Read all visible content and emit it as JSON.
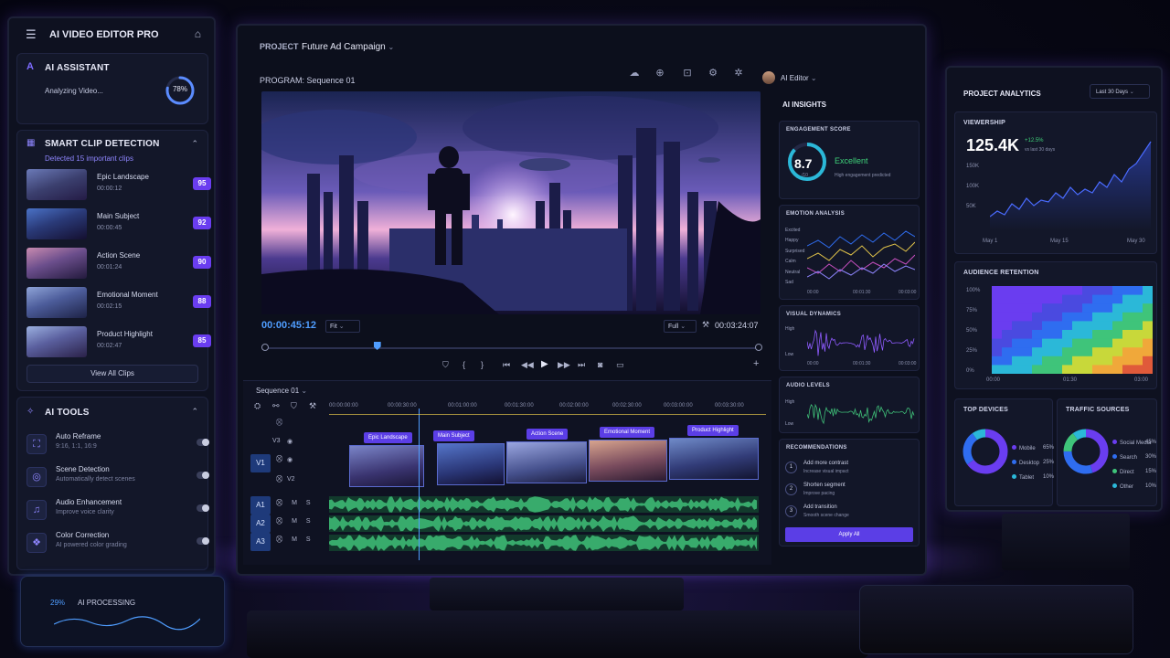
{
  "left": {
    "app_title": "AI VIDEO EDITOR PRO",
    "assistant": {
      "title": "AI ASSISTANT",
      "status": "Analyzing Video...",
      "progress_label": "78%",
      "progress": 0.78
    },
    "detection": {
      "title": "SMART CLIP DETECTION",
      "subtitle": "Detected 15 important clips",
      "clips": [
        {
          "title": "Epic Landscape",
          "time": "00:00:12",
          "score": "95"
        },
        {
          "title": "Main Subject",
          "time": "00:00:45",
          "score": "92"
        },
        {
          "title": "Action Scene",
          "time": "00:01:24",
          "score": "90"
        },
        {
          "title": "Emotional Moment",
          "time": "00:02:15",
          "score": "88"
        },
        {
          "title": "Product Highlight",
          "time": "00:02:47",
          "score": "85"
        }
      ],
      "view_all": "View All Clips"
    },
    "tools": {
      "title": "AI TOOLS",
      "items": [
        {
          "title": "Auto Reframe",
          "sub": "9:16, 1:1, 16:9"
        },
        {
          "title": "Scene Detection",
          "sub": "Automatically detect scenes"
        },
        {
          "title": "Audio Enhancement",
          "sub": "Improve voice clarity"
        },
        {
          "title": "Color Correction",
          "sub": "AI powered color grading"
        }
      ]
    }
  },
  "center": {
    "project_label": "PROJECT",
    "project_name": "Future Ad Campaign",
    "program_label": "PROGRAM: Sequence 01",
    "user": "AI Editor",
    "current_time": "00:00:45:12",
    "fit": "Fit",
    "full": "Full",
    "duration": "00:03:24:07",
    "playhead_fraction": 0.23,
    "sequence": "Sequence 01",
    "ruler": [
      "00:00:00:00",
      "00:00:30:00",
      "00:01:00:00",
      "00:01:30:00",
      "00:02:00:00",
      "00:02:30:00",
      "00:03:00:00",
      "00:03:30:00"
    ],
    "tracks": {
      "v3": "V3",
      "v2": "V2",
      "v1": "V1",
      "v2b": "V2",
      "a1": "A1",
      "a2": "A2",
      "a3": "A3"
    },
    "clip_tags": [
      "Epic Landscape",
      "Main Subject",
      "Action Scene",
      "Emotional Moment",
      "Product Highlight"
    ],
    "insights": {
      "title": "AI INSIGHTS",
      "engagement": {
        "title": "ENGAGEMENT SCORE",
        "score": "8.7",
        "out_of": "/10",
        "rating": "Excellent",
        "note": "High engagement predicted"
      },
      "emotion": {
        "title": "EMOTION ANALYSIS",
        "labels": [
          "Excited",
          "Happy",
          "Surprised",
          "Calm",
          "Neutral",
          "Sad"
        ],
        "times": [
          "00:00",
          "00:01:30",
          "00:03:00"
        ]
      },
      "visual": {
        "title": "VISUAL DYNAMICS",
        "high": "High",
        "low": "Low",
        "times": [
          "00:00",
          "00:01:30",
          "00:03:00"
        ]
      },
      "audio": {
        "title": "AUDIO LEVELS",
        "high": "High",
        "low": "Low"
      },
      "recommendations": {
        "title": "RECOMMENDATIONS",
        "items": [
          {
            "n": "1",
            "title": "Add more contrast",
            "sub": "Increase visual impact"
          },
          {
            "n": "2",
            "title": "Shorten segment",
            "sub": "Improve pacing"
          },
          {
            "n": "3",
            "title": "Add transition",
            "sub": "Smooth scene change"
          }
        ],
        "apply": "Apply All"
      }
    }
  },
  "right": {
    "title": "PROJECT ANALYTICS",
    "range": "Last 30 Days",
    "viewership": {
      "title": "VIEWERSHIP",
      "value": "125.4K",
      "change": "+12.5%",
      "change_note": "vs last 30 days",
      "y_ticks": [
        "150K",
        "100K",
        "50K"
      ],
      "x_ticks": [
        "May 1",
        "May 15",
        "May 30"
      ]
    },
    "retention": {
      "title": "AUDIENCE RETENTION",
      "y_ticks": [
        "100%",
        "75%",
        "50%",
        "25%",
        "0%"
      ],
      "x_ticks": [
        "00:00",
        "01:30",
        "03:00"
      ]
    },
    "devices": {
      "title": "TOP DEVICES",
      "items": [
        {
          "name": "Mobile",
          "pct": "65%",
          "value": 65,
          "color": "#6a3df0"
        },
        {
          "name": "Desktop",
          "pct": "25%",
          "value": 25,
          "color": "#2f6df0"
        },
        {
          "name": "Tablet",
          "pct": "10%",
          "value": 10,
          "color": "#2bb8d8"
        }
      ]
    },
    "traffic": {
      "title": "TRAFFIC SOURCES",
      "items": [
        {
          "name": "Social Media",
          "pct": "45%",
          "value": 45,
          "color": "#6a3df0"
        },
        {
          "name": "Search",
          "pct": "30%",
          "value": 30,
          "color": "#2f6df0"
        },
        {
          "name": "Direct",
          "pct": "15%",
          "value": 15,
          "color": "#3fc47a"
        },
        {
          "name": "Other",
          "pct": "10%",
          "value": 10,
          "color": "#2bb8d8"
        }
      ]
    }
  },
  "desk": {
    "processing_label": "AI PROCESSING",
    "processing_value": "29%"
  }
}
